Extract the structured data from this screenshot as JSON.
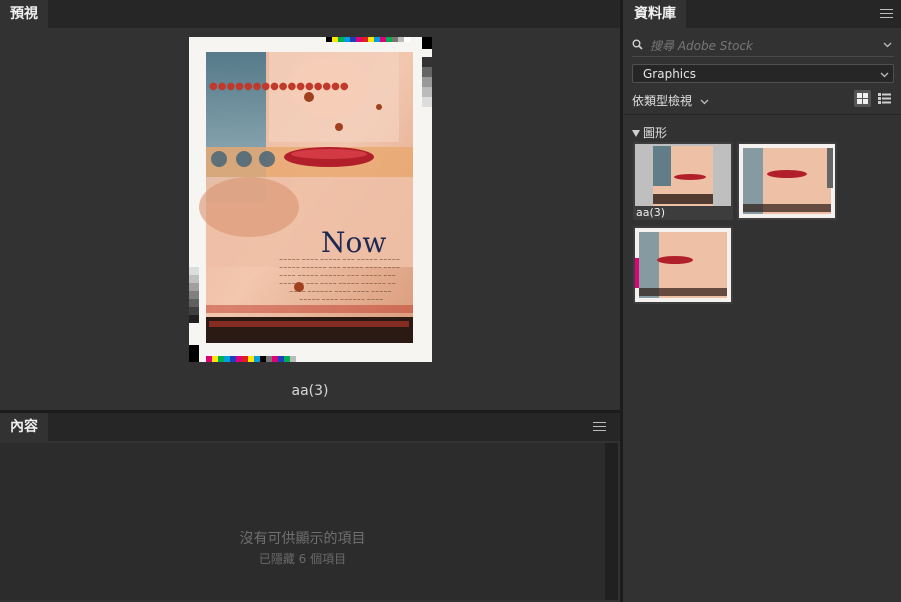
{
  "preview": {
    "tab_label": "預視",
    "filename": "aa(3)",
    "doc_headline": "Now"
  },
  "content": {
    "tab_label": "內容",
    "empty_message": "沒有可供顯示的項目",
    "hidden_message": "已隱藏 6 個項目"
  },
  "libraries": {
    "tab_label": "資料庫",
    "search": {
      "placeholder": "搜尋 Adobe Stock",
      "value": ""
    },
    "selected_library": "Graphics",
    "view_by_label": "依類型檢視",
    "group_name": "圖形",
    "items": [
      {
        "label": "aa(3)"
      },
      {
        "label": ""
      },
      {
        "label": ""
      }
    ]
  },
  "colors": {
    "background": "#323232",
    "tabbar": "#262626",
    "content_body": "#2c2c2c"
  },
  "icons": [
    "menu-icon",
    "search-icon",
    "chevron-down-icon",
    "grid-view-icon",
    "list-view-icon",
    "triangle-down-icon"
  ]
}
